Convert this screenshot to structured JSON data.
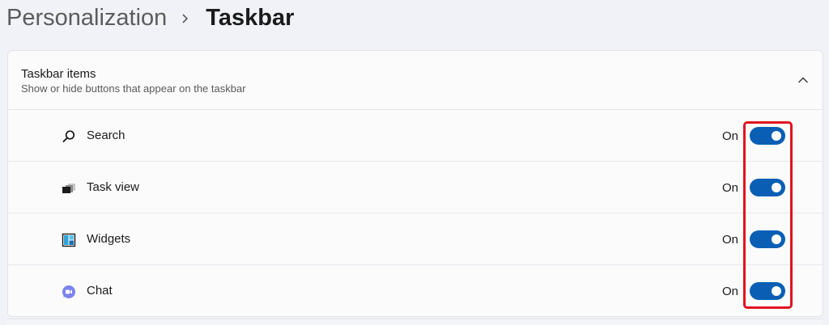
{
  "breadcrumb": {
    "parent": "Personalization",
    "separator_icon": "chevron-right-icon",
    "current": "Taskbar"
  },
  "section": {
    "title": "Taskbar items",
    "subtitle": "Show or hide buttons that appear on the taskbar",
    "collapse_icon": "chevron-up-icon",
    "expanded": true
  },
  "items": [
    {
      "label": "Search",
      "state": "On",
      "icon": "search-icon",
      "enabled": true
    },
    {
      "label": "Task view",
      "state": "On",
      "icon": "task-view-icon",
      "enabled": true
    },
    {
      "label": "Widgets",
      "state": "On",
      "icon": "widgets-icon",
      "enabled": true
    },
    {
      "label": "Chat",
      "state": "On",
      "icon": "chat-icon",
      "enabled": true
    }
  ],
  "colors": {
    "toggle_on": "#0a5fb5",
    "highlight": "#e0141e",
    "background": "#f0f2f7"
  }
}
